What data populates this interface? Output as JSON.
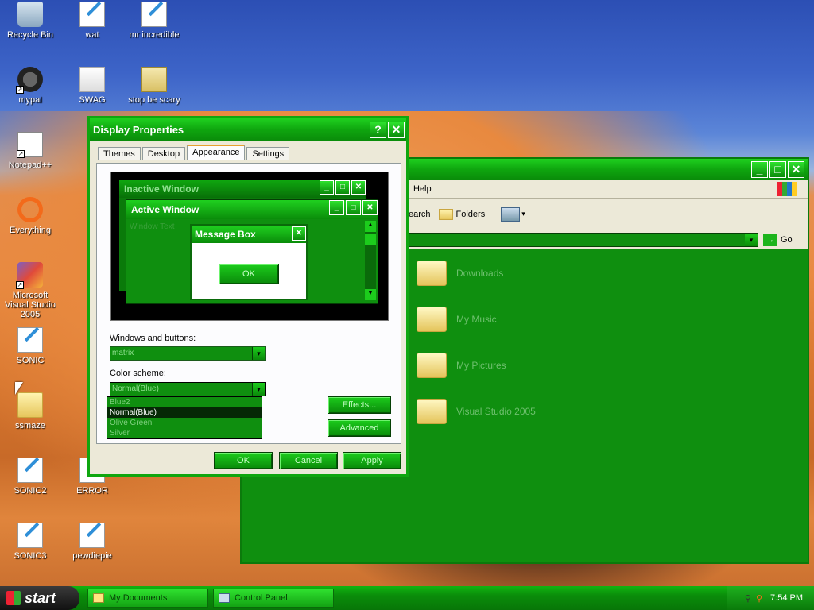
{
  "desktop": {
    "icons": [
      {
        "label": "Recycle Bin"
      },
      {
        "label": "wat"
      },
      {
        "label": "mr incredible"
      },
      {
        "label": "mypal"
      },
      {
        "label": "SWAG"
      },
      {
        "label": "stop be scary"
      },
      {
        "label": "Notepad++"
      },
      {
        "label": "Everything"
      },
      {
        "label": "Microsoft Visual Studio 2005"
      },
      {
        "label": "SONIC"
      },
      {
        "label": "ssmaze"
      },
      {
        "label": "SONIC2"
      },
      {
        "label": "ERROR"
      },
      {
        "label": "SONIC3"
      },
      {
        "label": "pewdiepie"
      }
    ]
  },
  "explorer": {
    "menu_help": "Help",
    "toolbar": {
      "search_fragment": "earch",
      "folders": "Folders"
    },
    "address_go": "Go",
    "items": [
      {
        "label": "Downloads"
      },
      {
        "label": "My Music"
      },
      {
        "label": "My Pictures"
      },
      {
        "label": "Visual Studio 2005"
      }
    ]
  },
  "dialog": {
    "title": "Display Properties",
    "help_button": "?",
    "close_button": "✕",
    "tabs": [
      "Themes",
      "Desktop",
      "Appearance",
      "Settings"
    ],
    "preview": {
      "inactive_title": "Inactive Window",
      "active_title": "Active Window",
      "window_text": "Window Text",
      "msgbox_title": "Message Box",
      "msgbox_ok": "OK"
    },
    "windows_buttons_label": "Windows and buttons:",
    "windows_buttons_value": "matrix",
    "color_scheme_label": "Color scheme:",
    "color_scheme_value": "Normal(Blue)",
    "color_scheme_options": [
      "Blue2",
      "Normal(Blue)",
      "Olive Green",
      "Silver"
    ],
    "effects_button": "Effects...",
    "advanced_button": "Advanced",
    "ok_button": "OK",
    "cancel_button": "Cancel",
    "apply_button": "Apply"
  },
  "taskbar": {
    "start_label": "start",
    "tasks": [
      "My Documents",
      "Control Panel"
    ],
    "clock": "7:54 PM"
  }
}
